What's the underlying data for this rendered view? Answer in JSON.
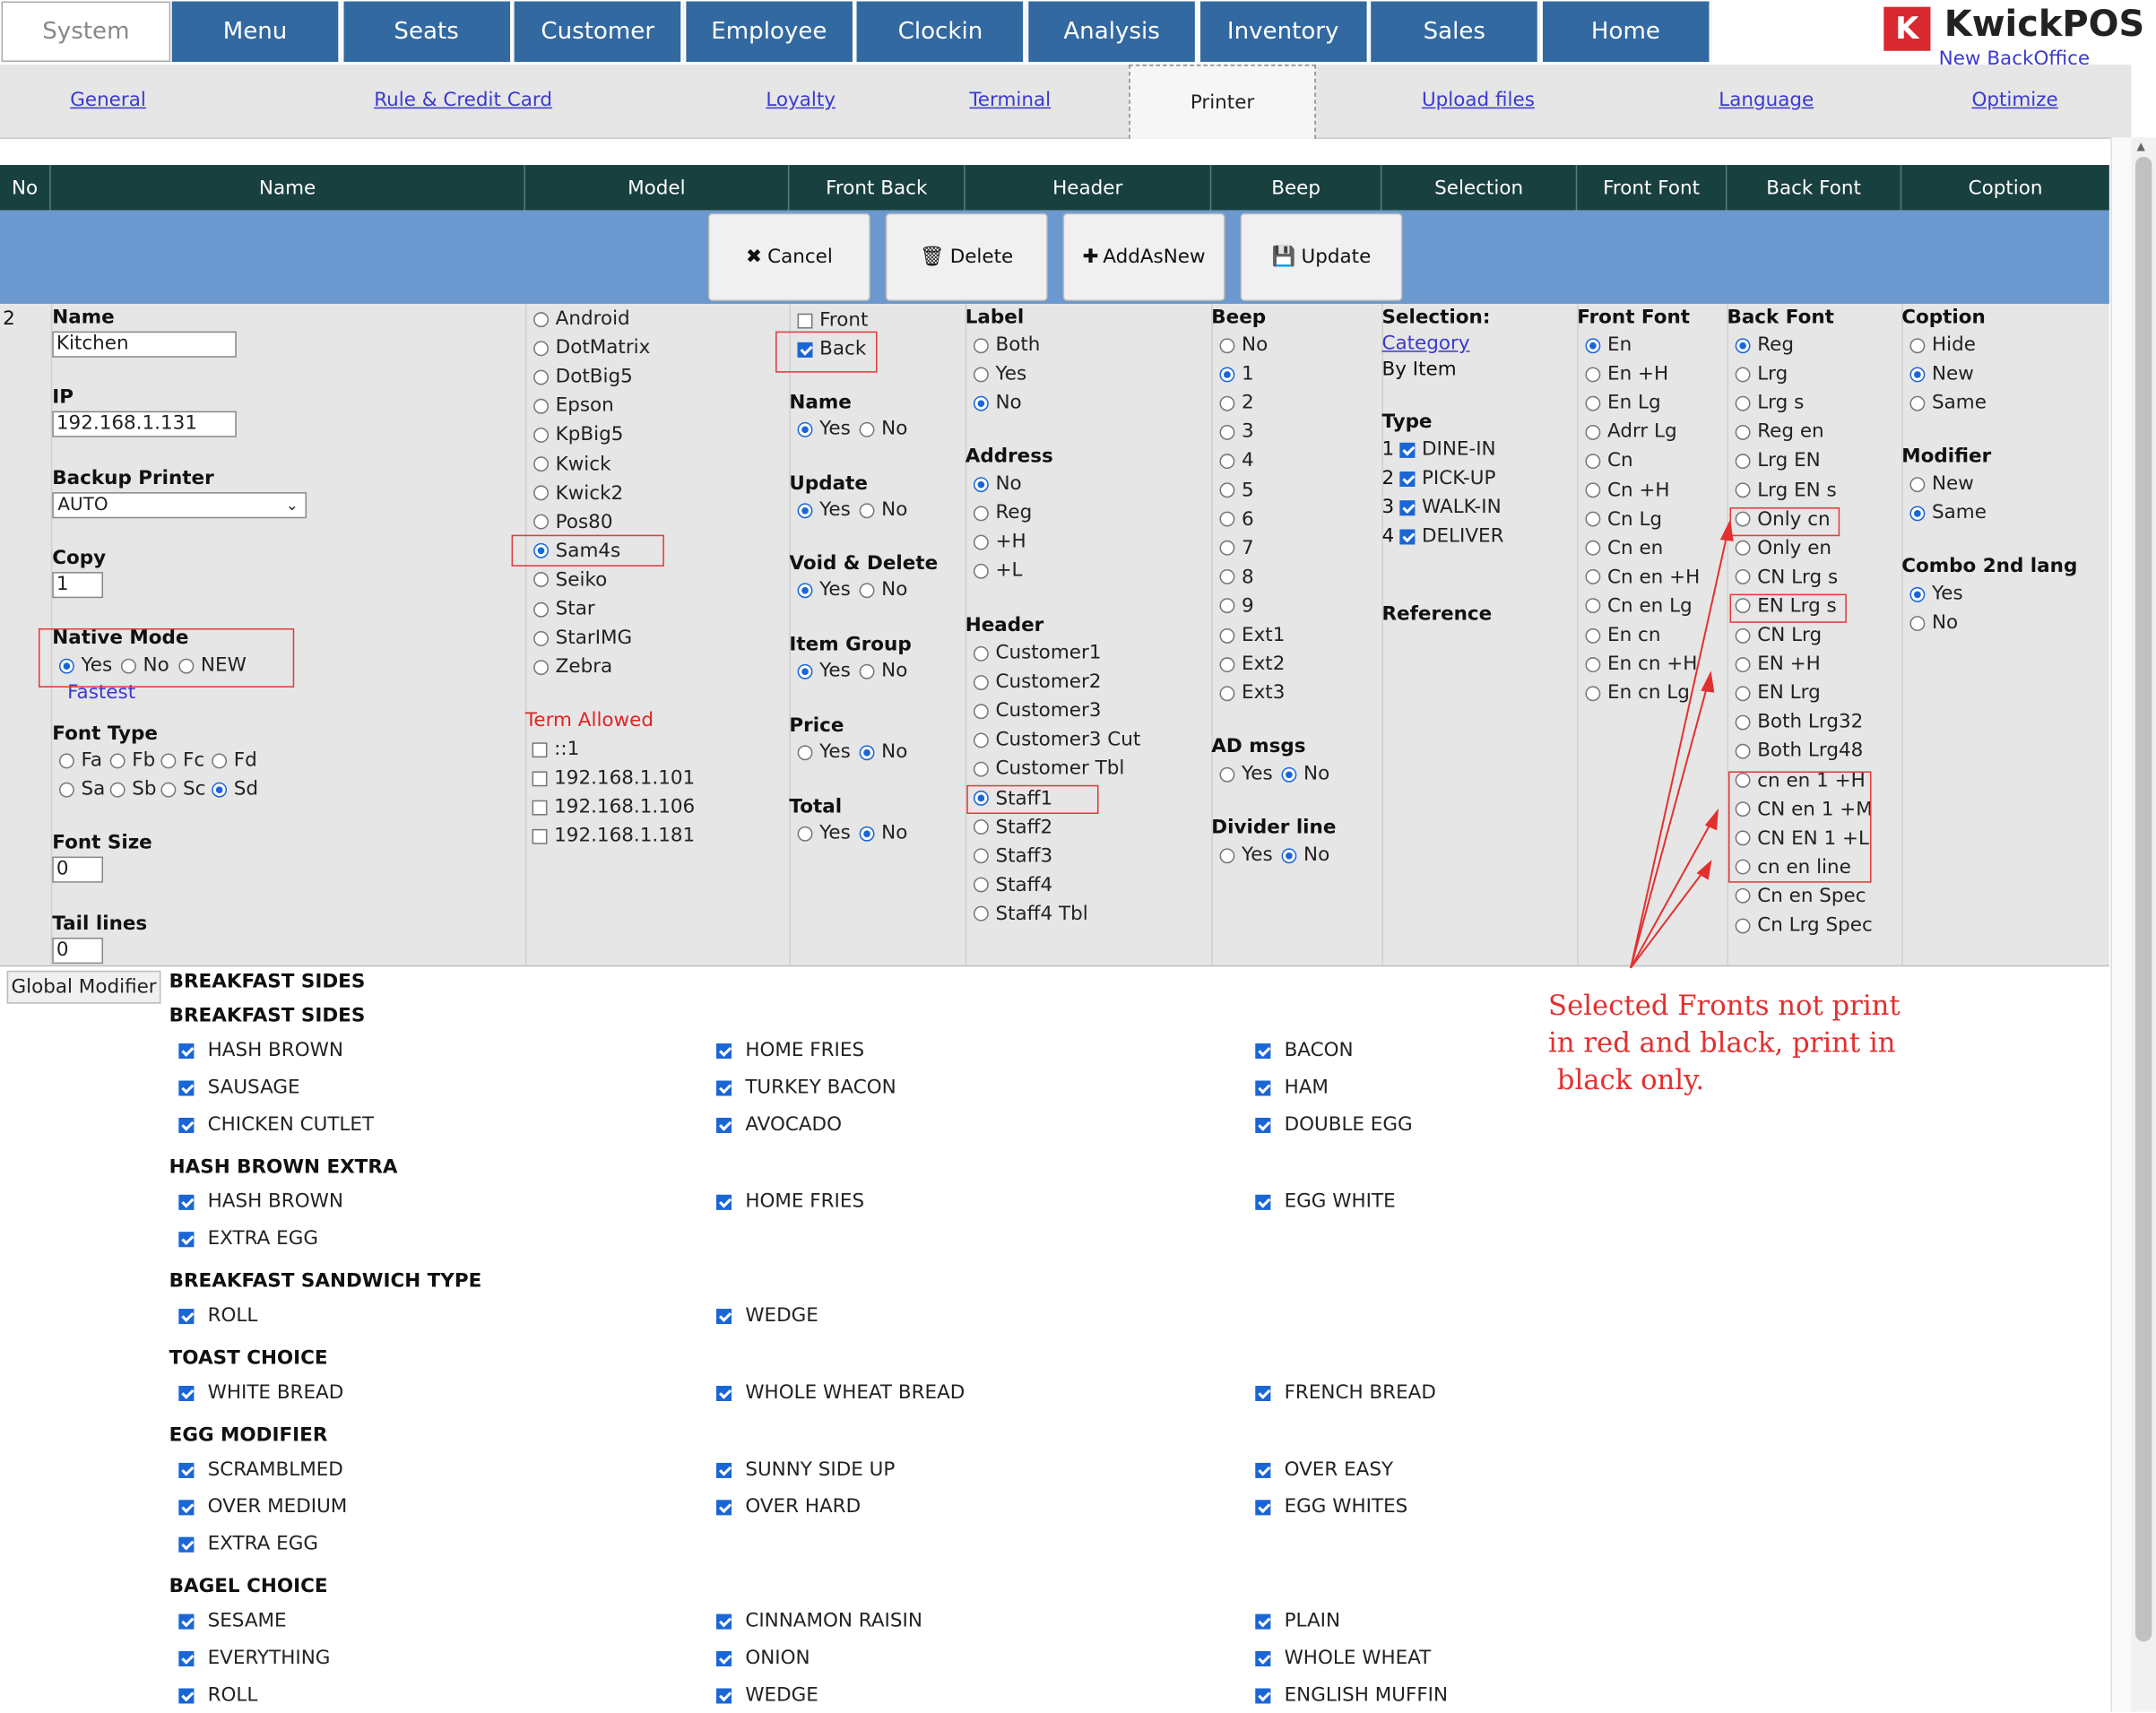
{
  "nav": {
    "system": "System",
    "items": [
      "Menu",
      "Seats",
      "Customer",
      "Employee",
      "Clockin",
      "Analysis",
      "Inventory",
      "Sales",
      "Home"
    ]
  },
  "logo": {
    "icon": "K",
    "name": "KwickPOS",
    "sub": "New BackOffice"
  },
  "subnav": {
    "links": [
      "General",
      "Rule & Credit Card",
      "Loyalty",
      "Terminal",
      "Upload files",
      "Language",
      "Optimize"
    ],
    "active": "Printer"
  },
  "columns": [
    "No",
    "Name",
    "Model",
    "Front Back",
    "Header",
    "Beep",
    "Selection",
    "Front Font",
    "Back Font",
    "Coption"
  ],
  "actions": {
    "cancel": "Cancel",
    "delete": "Delete",
    "addasnew": "AddAsNew",
    "update": "Update"
  },
  "icons": {
    "cancel": "x-icon",
    "delete": "trash-icon",
    "add": "plus-icon",
    "update": "save-icon"
  },
  "row_no": "2",
  "name_col": {
    "name_label": "Name",
    "name_value": "Kitchen",
    "ip_label": "IP",
    "ip_value": "192.168.1.131",
    "backup_label": "Backup Printer",
    "backup_value": "AUTO",
    "copy_label": "Copy",
    "copy_value": "1",
    "native_label": "Native Mode",
    "native_opts": [
      "Yes",
      "No",
      "NEW"
    ],
    "native_selected": "Yes",
    "fastest": "Fastest",
    "fonttype_label": "Font Type",
    "fonttype_opts": [
      "Fa",
      "Fb",
      "Fc",
      "Fd",
      "Sa",
      "Sb",
      "Sc",
      "Sd"
    ],
    "fonttype_selected": "Sd",
    "fontsize_label": "Font Size",
    "fontsize_value": "0",
    "tail_label": "Tail lines",
    "tail_value": "0"
  },
  "model_col": {
    "models": [
      "Android",
      "DotMatrix",
      "DotBig5",
      "Epson",
      "KpBig5",
      "Kwick",
      "Kwick2",
      "Pos80",
      "Sam4s",
      "Seiko",
      "Star",
      "StarIMG",
      "Zebra"
    ],
    "selected": "Sam4s",
    "term_label": "Term Allowed",
    "terms": [
      "::1",
      "192.168.1.101",
      "192.168.1.106",
      "192.168.1.181"
    ]
  },
  "frontback_col": {
    "front": "Front",
    "back": "Back",
    "groups": [
      {
        "label": "Name",
        "selected": "Yes"
      },
      {
        "label": "Update",
        "selected": "Yes"
      },
      {
        "label": "Void & Delete",
        "selected": "Yes"
      },
      {
        "label": "Item Group",
        "selected": "Yes"
      },
      {
        "label": "Price",
        "selected": "No"
      },
      {
        "label": "Total",
        "selected": "No"
      }
    ],
    "yes": "Yes",
    "no": "No"
  },
  "header_col": {
    "label_label": "Label",
    "label_opts": [
      "Both",
      "Yes",
      "No"
    ],
    "label_selected": "No",
    "address_label": "Address",
    "address_opts": [
      "No",
      "Reg",
      "+H",
      "+L"
    ],
    "address_selected": "No",
    "header_label": "Header",
    "header_opts": [
      "Customer1",
      "Customer2",
      "Customer3",
      "Customer3 Cut",
      "Customer Tbl",
      "Staff1",
      "Staff2",
      "Staff3",
      "Staff4",
      "Staff4 Tbl"
    ],
    "header_selected": "Staff1"
  },
  "beep_col": {
    "beep_label": "Beep",
    "beep_opts": [
      "No",
      "1",
      "2",
      "3",
      "4",
      "5",
      "6",
      "7",
      "8",
      "9",
      "Ext1",
      "Ext2",
      "Ext3"
    ],
    "beep_selected": "1",
    "ad_label": "AD msgs",
    "ad_selected": "No",
    "divider_label": "Divider line",
    "divider_selected": "No"
  },
  "selection_col": {
    "label": "Selection:",
    "category": "Category",
    "byitem": "By Item",
    "type_label": "Type",
    "types": [
      {
        "n": "1",
        "t": "DINE-IN"
      },
      {
        "n": "2",
        "t": "PICK-UP"
      },
      {
        "n": "3",
        "t": "WALK-IN"
      },
      {
        "n": "4",
        "t": "DELIVER"
      }
    ],
    "reference": "Reference"
  },
  "frontfont_col": {
    "label": "Front Font",
    "opts": [
      "En",
      "En +H",
      "En Lg",
      "Adrr Lg",
      "Cn",
      "Cn +H",
      "Cn Lg",
      "Cn en",
      "Cn en +H",
      "Cn en Lg",
      "En cn",
      "En cn +H",
      "En cn Lg"
    ],
    "selected": "En"
  },
  "backfont_col": {
    "label": "Back Font",
    "opts": [
      "Reg",
      "Lrg",
      "Lrg s",
      "Reg en",
      "Lrg EN",
      "Lrg EN s",
      "Only cn",
      "Only en",
      "CN Lrg s",
      "EN Lrg s",
      "CN Lrg",
      "EN +H",
      "EN Lrg",
      "Both Lrg32",
      "Both Lrg48",
      "cn en 1 +H",
      "CN en 1 +M",
      "CN EN 1 +L",
      "cn en line",
      "Cn en Spec",
      "Cn Lrg Spec"
    ],
    "selected": "Reg"
  },
  "coption_col": {
    "coption_label": "Coption",
    "coption_opts": [
      "Hide",
      "New",
      "Same"
    ],
    "coption_selected": "New",
    "modifier_label": "Modifier",
    "modifier_opts": [
      "New",
      "Same"
    ],
    "modifier_selected": "Same",
    "combo_label": "Combo 2nd lang",
    "combo_opts": [
      "Yes",
      "No"
    ],
    "combo_selected": "Yes"
  },
  "global_modifier": "Global Modifier",
  "top_section": "BREAKFAST SIDES",
  "sections": [
    {
      "title": "BREAKFAST SIDES",
      "items": [
        "HASH BROWN",
        "HOME FRIES",
        "BACON",
        "SAUSAGE",
        "TURKEY BACON",
        "HAM",
        "CHICKEN CUTLET",
        "AVOCADO",
        "DOUBLE EGG"
      ]
    },
    {
      "title": "HASH BROWN EXTRA",
      "items": [
        "HASH BROWN",
        "HOME FRIES",
        "EGG WHITE",
        "EXTRA EGG"
      ]
    },
    {
      "title": "BREAKFAST SANDWICH TYPE",
      "items": [
        "ROLL",
        "WEDGE"
      ]
    },
    {
      "title": "TOAST CHOICE",
      "items": [
        "WHITE BREAD",
        "WHOLE WHEAT BREAD",
        "FRENCH BREAD"
      ]
    },
    {
      "title": "EGG MODIFIER",
      "items": [
        "SCRAMBLMED",
        "SUNNY SIDE UP",
        "OVER EASY",
        "OVER MEDIUM",
        "OVER HARD",
        "EGG WHITES",
        "EXTRA EGG"
      ]
    },
    {
      "title": "BAGEL CHOICE",
      "items": [
        "SESAME",
        "CINNAMON RAISIN",
        "PLAIN",
        "EVERYTHING",
        "ONION",
        "WHOLE WHEAT",
        "ROLL",
        "WEDGE",
        "ENGLISH MUFFIN"
      ]
    }
  ],
  "annotation": "Selected Fronts not print\nin red and black, print in\n black only.",
  "colors": {
    "nav": "#3369a1",
    "header": "#18403f",
    "actionbar": "#6a98cf",
    "annotation": "#e23030",
    "accent": "#1a66d6"
  }
}
